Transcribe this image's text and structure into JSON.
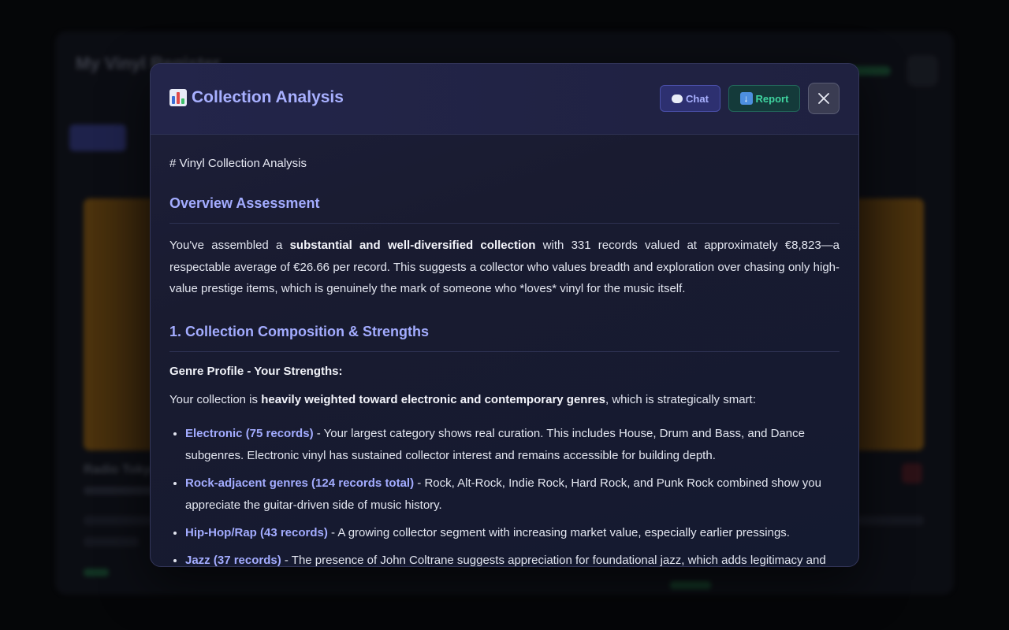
{
  "background": {
    "title": "My Vinyl Register",
    "card_title": "Radio Tokyo"
  },
  "modal": {
    "title": "Collection Analysis",
    "buttons": {
      "chat": "Chat",
      "report": "Report"
    },
    "colors": {
      "accent": "#a3acff",
      "chat_bg": "#2d3070",
      "report_text": "#3fd4a0"
    }
  },
  "content": {
    "h1": "# Vinyl Collection Analysis",
    "overview": {
      "heading": "Overview Assessment",
      "p1_a": "You've assembled a ",
      "p1_b": "substantial and well-diversified collection",
      "p1_c": " with 331 records valued at approximately €8,823—a respectable average of €26.66 per record. This suggests a collector who values breadth and exploration over chasing only high-value prestige items, which is genuinely the mark of someone who *loves* vinyl for the music itself."
    },
    "composition": {
      "heading": "1. Collection Composition & Strengths",
      "genre_heading": "Genre Profile - Your Strengths:",
      "p_a": "Your collection is ",
      "p_b": "heavily weighted toward electronic and contemporary genres",
      "p_c": ", which is strategically smart:",
      "items": [
        {
          "label": "Electronic (75 records)",
          "text": " - Your largest category shows real curation. This includes House, Drum and Bass, and Dance subgenres. Electronic vinyl has sustained collector interest and remains accessible for building depth."
        },
        {
          "label": "Rock-adjacent genres (124 records total)",
          "text": " - Rock, Alt-Rock, Indie Rock, Hard Rock, and Punk Rock combined show you appreciate the guitar-driven side of music history."
        },
        {
          "label": "Hip-Hop/Rap (43 records)",
          "text": " - A growing collector segment with increasing market value, especially earlier pressings."
        },
        {
          "label": "Jazz (37 records)",
          "text": " - The presence of John Coltrane suggests appreciation for foundational jazz, which adds legitimacy and"
        }
      ]
    }
  }
}
